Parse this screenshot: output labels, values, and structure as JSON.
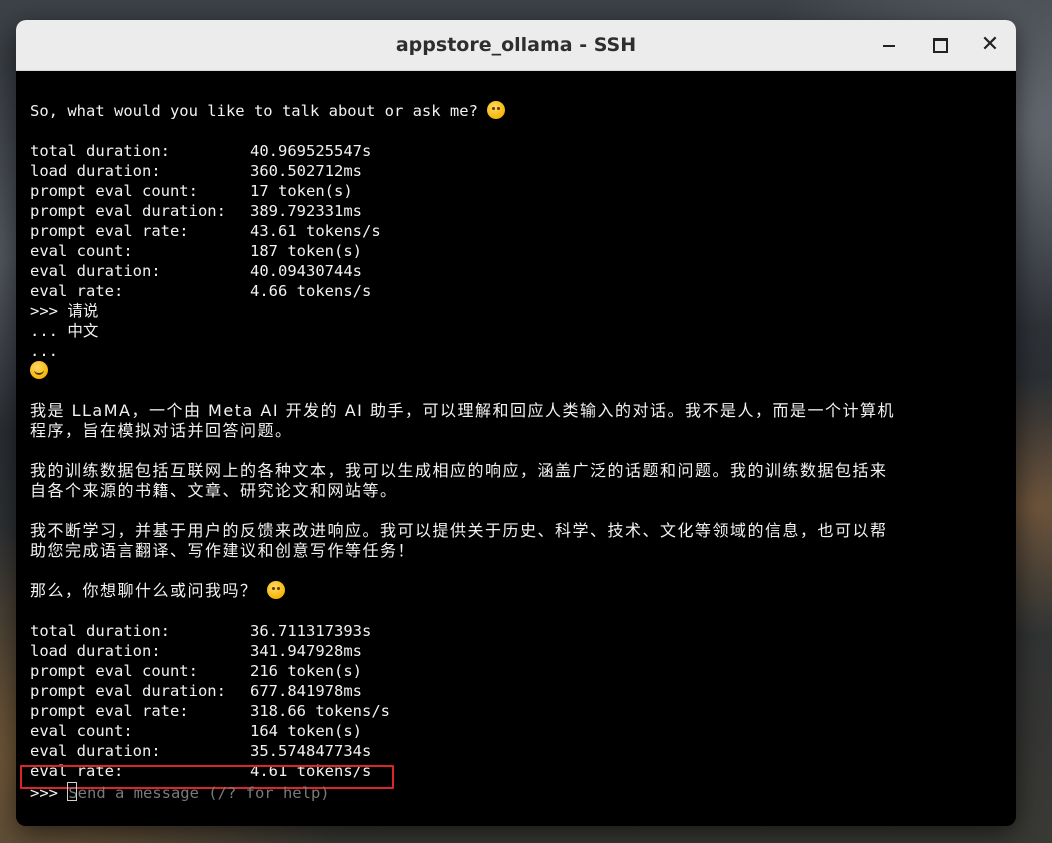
{
  "window": {
    "title": "appstore_ollama - SSH",
    "controls": {
      "minimize_icon": "minimize-icon",
      "maximize_icon": "maximize-icon",
      "close_icon": "close-icon",
      "close_glyph": "✕"
    }
  },
  "terminal": {
    "intro_line": "So, what would you like to talk about or ask me?",
    "stats_1": [
      {
        "key": "total duration:",
        "value": "40.969525547s"
      },
      {
        "key": "load duration:",
        "value": "360.502712ms"
      },
      {
        "key": "prompt eval count:",
        "value": "17 token(s)"
      },
      {
        "key": "prompt eval duration:",
        "value": "389.792331ms"
      },
      {
        "key": "prompt eval rate:",
        "value": "43.61 tokens/s"
      },
      {
        "key": "eval count:",
        "value": "187 token(s)"
      },
      {
        "key": "eval duration:",
        "value": "40.09430744s"
      },
      {
        "key": "eval rate:",
        "value": "4.66 tokens/s"
      }
    ],
    "user_input": [
      ">>> 请说",
      "... 中文",
      "..."
    ],
    "reply_paragraphs": [
      [
        "我是 LLaMA，一个由 Meta AI 开发的 AI 助手，可以理解和回应人类输入的对话。我不是人，而是一个计算机",
        "程序，旨在模拟对话并回答问题。"
      ],
      [
        "我的训练数据包括互联网上的各种文本，我可以生成相应的响应，涵盖广泛的话题和问题。我的训练数据包括来",
        "自各个来源的书籍、文章、研究论文和网站等。"
      ],
      [
        "我不断学习，并基于用户的反馈来改进响应。我可以提供关于历史、科学、技术、文化等领域的信息，也可以帮",
        "助您完成语言翻译、写作建议和创意写作等任务！"
      ]
    ],
    "closing_line": "那么，你想聊什么或问我吗？",
    "stats_2": [
      {
        "key": "total duration:",
        "value": "36.711317393s"
      },
      {
        "key": "load duration:",
        "value": "341.947928ms"
      },
      {
        "key": "prompt eval count:",
        "value": "216 token(s)"
      },
      {
        "key": "prompt eval duration:",
        "value": "677.841978ms"
      },
      {
        "key": "prompt eval rate:",
        "value": "318.66 tokens/s"
      },
      {
        "key": "eval count:",
        "value": "164 token(s)"
      },
      {
        "key": "eval duration:",
        "value": "35.574847734s"
      },
      {
        "key": "eval rate:",
        "value": "4.61 tokens/s"
      }
    ],
    "prompt": ">>> ",
    "input_placeholder": "Send a message (/? for help)"
  },
  "colors": {
    "terminal_bg": "#000000",
    "terminal_fg": "#f2f2f2",
    "highlight_border": "#d9262b",
    "titlebar_bg": "#ececec"
  }
}
